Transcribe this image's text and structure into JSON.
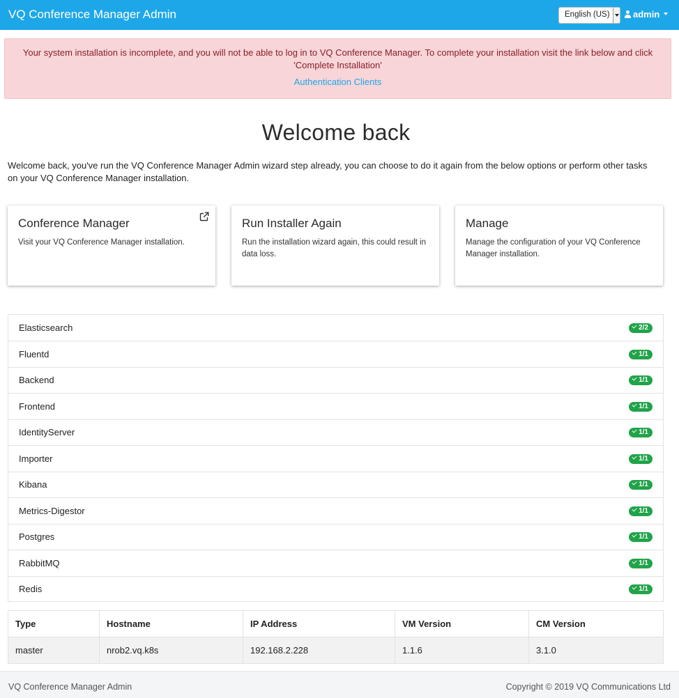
{
  "header": {
    "brand": "VQ Conference Manager Admin",
    "language": "English (US)",
    "user": "admin"
  },
  "alert": {
    "message": "Your system installation is incomplete, and you will not be able to log in to VQ Conference Manager. To complete your installation visit the link below and click 'Complete Installation'",
    "link": "Authentication Clients"
  },
  "welcome": {
    "title": "Welcome back",
    "text": "Welcome back, you've run the VQ Conference Manager Admin wizard step already, you can choose to do it again from the below options or perform other tasks on your VQ Conference Manager installation."
  },
  "cards": [
    {
      "title": "Conference Manager",
      "desc": "Visit your VQ Conference Manager installation.",
      "icon": "external-link-icon"
    },
    {
      "title": "Run Installer Again",
      "desc": "Run the installation wizard again, this could result in data loss."
    },
    {
      "title": "Manage",
      "desc": "Manage the configuration of your VQ Conference Manager installation."
    }
  ],
  "services": [
    {
      "name": "Elasticsearch",
      "status": "2/2"
    },
    {
      "name": "Fluentd",
      "status": "1/1"
    },
    {
      "name": "Backend",
      "status": "1/1"
    },
    {
      "name": "Frontend",
      "status": "1/1"
    },
    {
      "name": "IdentityServer",
      "status": "1/1"
    },
    {
      "name": "Importer",
      "status": "1/1"
    },
    {
      "name": "Kibana",
      "status": "1/1"
    },
    {
      "name": "Metrics-Digestor",
      "status": "1/1"
    },
    {
      "name": "Postgres",
      "status": "1/1"
    },
    {
      "name": "RabbitMQ",
      "status": "1/1"
    },
    {
      "name": "Redis",
      "status": "1/1"
    }
  ],
  "nodes": {
    "headers": [
      "Type",
      "Hostname",
      "IP Address",
      "VM Version",
      "CM Version"
    ],
    "rows": [
      [
        "master",
        "nrob2.vq.k8s",
        "192.168.2.228",
        "1.1.6",
        "3.1.0"
      ]
    ]
  },
  "footer": {
    "left": "VQ Conference Manager Admin",
    "right": "Copyright © 2019 VQ Communications Ltd"
  },
  "colors": {
    "navbar": "#1ea7e8",
    "badge": "#21a34a",
    "alert_bg": "#f7d5d8",
    "alert_text": "#8a1f2a"
  }
}
